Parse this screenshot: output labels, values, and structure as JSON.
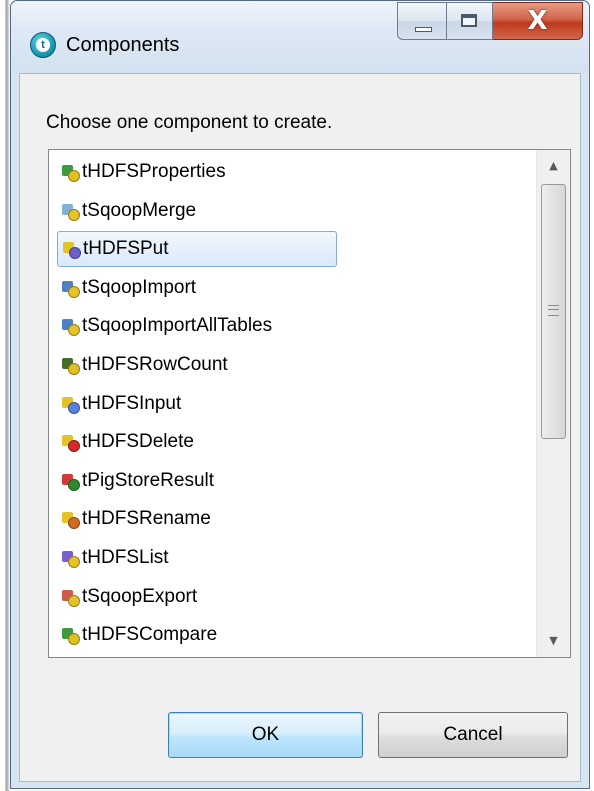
{
  "window": {
    "title": "Components",
    "icon": "talend-t-icon",
    "close_glyph": "X"
  },
  "dialog": {
    "prompt": "Choose one component to create."
  },
  "components": [
    {
      "label": "tHDFSProperties",
      "icon": "hdfs-properties-icon",
      "colors": [
        "#3d9b3d",
        "#e0c020"
      ]
    },
    {
      "label": "tSqoopMerge",
      "icon": "sqoop-merge-icon",
      "colors": [
        "#7fb2d6",
        "#e6c229"
      ]
    },
    {
      "label": "tHDFSPut",
      "icon": "hdfs-put-icon",
      "colors": [
        "#e6c229",
        "#6c5fc7"
      ],
      "selected": true
    },
    {
      "label": "tSqoopImport",
      "icon": "sqoop-import-icon",
      "colors": [
        "#4f7fc4",
        "#e6c229"
      ]
    },
    {
      "label": "tSqoopImportAllTables",
      "icon": "sqoop-import-all-tables-icon",
      "colors": [
        "#4f7fc4",
        "#e6c229"
      ]
    },
    {
      "label": "tHDFSRowCount",
      "icon": "hdfs-row-count-icon",
      "colors": [
        "#4a6a2a",
        "#e0c020"
      ]
    },
    {
      "label": "tHDFSInput",
      "icon": "hdfs-input-icon",
      "colors": [
        "#e6c229",
        "#5a7fe0"
      ]
    },
    {
      "label": "tHDFSDelete",
      "icon": "hdfs-delete-icon",
      "colors": [
        "#e6c229",
        "#d42a2a"
      ]
    },
    {
      "label": "tPigStoreResult",
      "icon": "pig-store-result-icon",
      "colors": [
        "#d43a3a",
        "#2f8a2f"
      ]
    },
    {
      "label": "tHDFSRename",
      "icon": "hdfs-rename-icon",
      "colors": [
        "#e6c229",
        "#d06a20"
      ]
    },
    {
      "label": "tHDFSList",
      "icon": "hdfs-list-icon",
      "colors": [
        "#7a5fd0",
        "#e6c229"
      ]
    },
    {
      "label": "tSqoopExport",
      "icon": "sqoop-export-icon",
      "colors": [
        "#d05a4a",
        "#e6c229"
      ]
    },
    {
      "label": "tHDFSCompare",
      "icon": "hdfs-compare-icon",
      "colors": [
        "#3d9b3d",
        "#e0c020"
      ]
    }
  ],
  "scrollbar": {
    "up_glyph": "▲",
    "down_glyph": "▼"
  },
  "buttons": {
    "ok_label": "OK",
    "cancel_label": "Cancel"
  },
  "colors": {
    "selection_border": "#84acdd",
    "default_button_border": "#3c7fb1",
    "close_button": "#c9472b"
  }
}
